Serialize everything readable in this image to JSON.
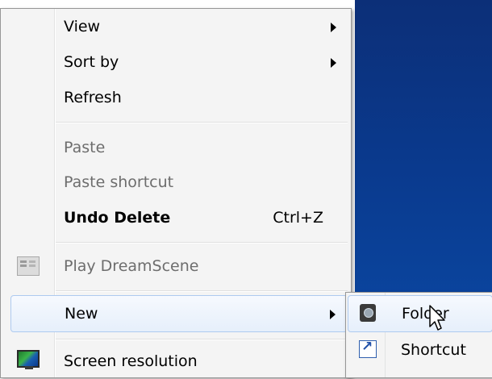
{
  "menu": {
    "items": [
      {
        "label": "View",
        "submenu": true
      },
      {
        "label": "Sort by",
        "submenu": true
      },
      {
        "label": "Refresh"
      },
      {
        "label": "Paste",
        "disabled": true
      },
      {
        "label": "Paste shortcut",
        "disabled": true
      },
      {
        "label": "Undo Delete",
        "accelerator": "Ctrl+Z",
        "bold": true
      },
      {
        "label": "Play DreamScene",
        "disabled": true,
        "icon": "dreamscene-icon"
      },
      {
        "label": "New",
        "submenu": true,
        "highlighted": true
      },
      {
        "label": "Screen resolution",
        "icon": "screen-resolution-icon"
      }
    ]
  },
  "submenu_new": {
    "items": [
      {
        "label": "Folder",
        "icon": "folder-icon",
        "highlighted": true
      },
      {
        "label": "Shortcut",
        "icon": "shortcut-icon"
      }
    ]
  },
  "colors": {
    "desktop_blue": "#0a3a8e",
    "menu_bg": "#f4f4f4",
    "highlight_border": "#aecaf0",
    "disabled_text": "#6d6d6d"
  }
}
